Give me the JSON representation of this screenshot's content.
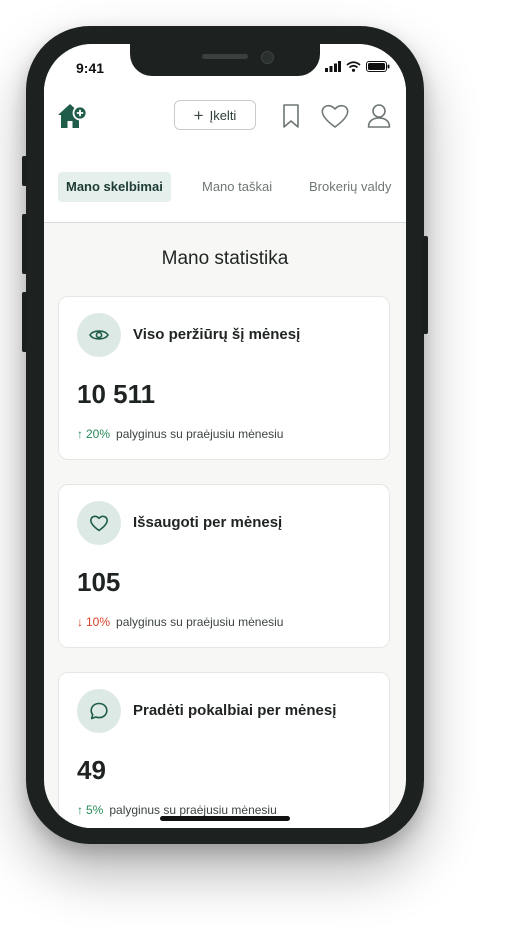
{
  "status": {
    "time": "9:41"
  },
  "header": {
    "upload_label": "Įkelti"
  },
  "tabs": [
    {
      "label": "Mano skelbimai",
      "active": true
    },
    {
      "label": "Mano taškai",
      "active": false
    },
    {
      "label": "Brokerių valdy",
      "active": false
    }
  ],
  "section_title": "Mano statistika",
  "cards": [
    {
      "icon": "eye-icon",
      "title": "Viso peržiūrų šį mėnesį",
      "value": "10 511",
      "change_arrow": "↑",
      "change": "20%",
      "direction": "up",
      "compare": "palyginus su praėjusiu mėnesiu"
    },
    {
      "icon": "heart-icon",
      "title": "Išsaugoti per mėnesį",
      "value": "105",
      "change_arrow": "↓",
      "change": "10%",
      "direction": "down",
      "compare": "palyginus su praėjusiu mėnesiu"
    },
    {
      "icon": "chat-bubble-icon",
      "title": "Pradėti pokalbiai per mėnesį",
      "value": "49",
      "change_arrow": "↑",
      "change": "5%",
      "direction": "up",
      "compare": "palyginus su praėjusiu mėnesiu"
    }
  ],
  "colors": {
    "accent": "#1f5c4a",
    "accent_light": "#dde9e5",
    "up": "#2a8a5a",
    "down": "#d9402b"
  }
}
